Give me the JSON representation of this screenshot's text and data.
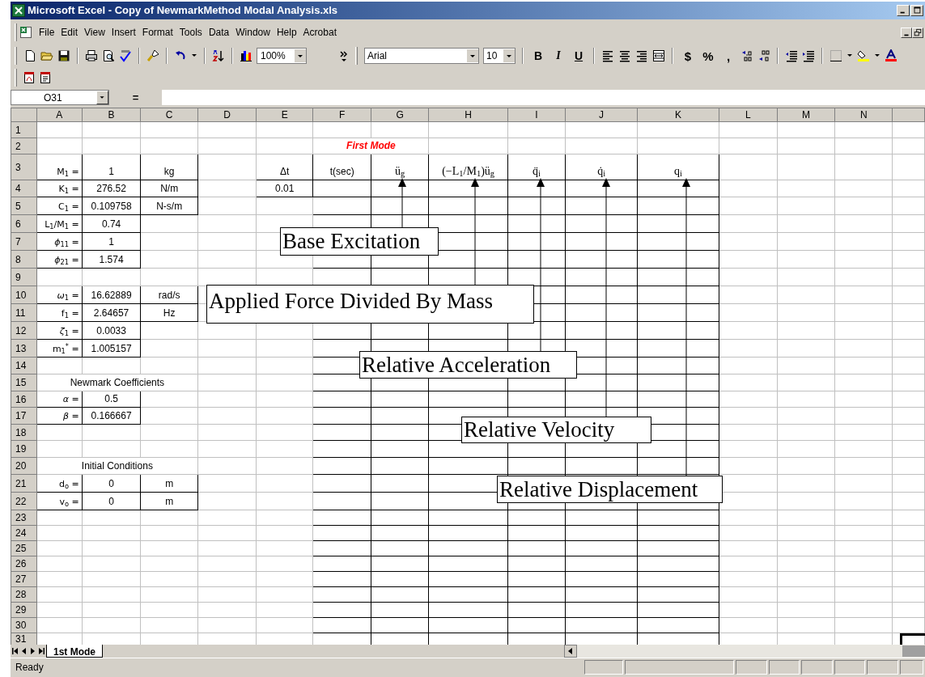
{
  "window": {
    "title": "Microsoft Excel - Copy of NewmarkMethod Modal Analysis.xls"
  },
  "menu": [
    "File",
    "Edit",
    "View",
    "Insert",
    "Format",
    "Tools",
    "Data",
    "Window",
    "Help",
    "Acrobat"
  ],
  "toolbar": {
    "zoom": "100%",
    "font": "Arial",
    "font_size": "10",
    "text_buttons": [
      "B",
      "I",
      "U"
    ],
    "number_buttons": [
      "$",
      "%",
      ","
    ]
  },
  "formula_bar": {
    "name_box": "O31",
    "equals": "="
  },
  "columns": [
    "A",
    "B",
    "C",
    "D",
    "E",
    "F",
    "G",
    "H",
    "I",
    "J",
    "K",
    "L",
    "M",
    "N"
  ],
  "row_numbers": [
    "1",
    "2",
    "3",
    "4",
    "5",
    "6",
    "7",
    "8",
    "9",
    "10",
    "11",
    "12",
    "13",
    "14",
    "15",
    "16",
    "17",
    "18",
    "19",
    "20",
    "21",
    "22",
    "23",
    "24",
    "25",
    "26",
    "27",
    "28",
    "29",
    "30",
    "31"
  ],
  "sheet_title": "First Mode",
  "parameters": [
    {
      "label": "M$_{1}$ =",
      "value": "1",
      "unit": "kg"
    },
    {
      "label": "K$_{1}$ =",
      "value": "276.52",
      "unit": "N/m"
    },
    {
      "label": "C$_{1}$ =",
      "value": "0.109758",
      "unit": "N-s/m"
    },
    {
      "label": "L$_{1}$/M$_{1}$ =",
      "value": "0.74"
    },
    {
      "label": "*ϕ*$_{11}$ =",
      "value": "1"
    },
    {
      "label": "*ϕ*$_{21}$ =",
      "value": "1.574"
    },
    {
      "label": "*ω*$_{1}$ =",
      "value": "16.62889",
      "unit": "rad/s"
    },
    {
      "label": "f$_{1}$ =",
      "value": "2.64657",
      "unit": "Hz"
    },
    {
      "label": "*ζ*$_{1}$ =",
      "value": "0.0033"
    },
    {
      "label": "m$_{1}$$^{*}$ =",
      "value": "1.005157"
    }
  ],
  "response_table": {
    "headings": [
      "Δt",
      "t(sec)",
      "ü$_{g}$",
      "(−L$_{1}$/M$_{1}$)ü$_{g}$",
      "q̈$_{i}$",
      "q̇$_{i}$",
      "q$_{i}$"
    ],
    "time_step": "0.01"
  },
  "newmark_coefficients": {
    "heading": "Newmark Coefficients",
    "rows": [
      {
        "label": "*α* =",
        "value": "0.5"
      },
      {
        "label": "*β* =",
        "value": "0.166667"
      }
    ]
  },
  "initial_conditions": {
    "heading": "Initial Conditions",
    "rows": [
      {
        "label": "d$_{o}$ =",
        "value": "0",
        "unit": "m"
      },
      {
        "label": "v$_{o}$ =",
        "value": "0",
        "unit": "m"
      }
    ]
  },
  "callouts": [
    {
      "text": "Base Excitation"
    },
    {
      "text": "Applied Force Divided By Mass"
    },
    {
      "text": "Relative Acceleration"
    },
    {
      "text": "Relative Velocity"
    },
    {
      "text": "Relative Displacement"
    }
  ],
  "sheet_tabs": [
    {
      "label": "1st Mode",
      "selected": true
    }
  ],
  "status_bar": {
    "text": "Ready"
  }
}
